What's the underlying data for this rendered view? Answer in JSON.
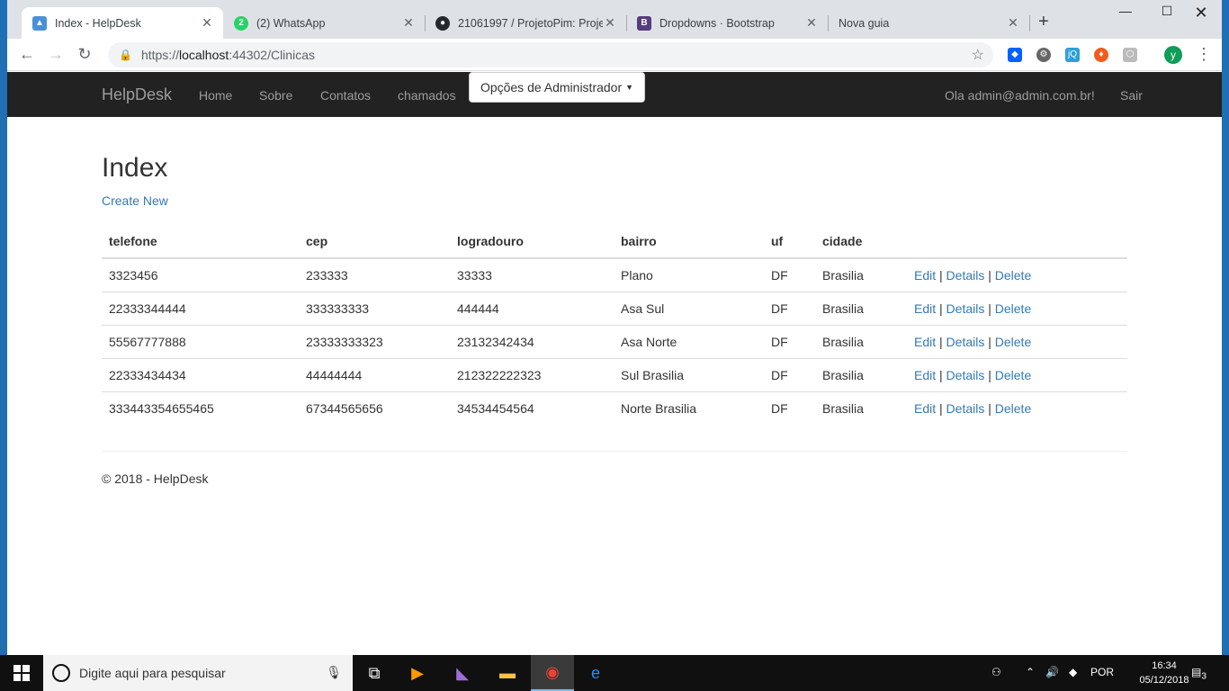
{
  "browser": {
    "tabs": [
      {
        "label": "Index - HelpDesk",
        "icon": "helpdesk-icon",
        "active": true
      },
      {
        "label": "(2) WhatsApp",
        "icon": "whatsapp-icon",
        "badge": "2"
      },
      {
        "label": "21061997 / ProjetoPim: Projet",
        "icon": "github-icon"
      },
      {
        "label": "Dropdowns · Bootstrap",
        "icon": "bootstrap-icon",
        "badge": "B"
      },
      {
        "label": "Nova guia",
        "icon": "blank-tab-icon"
      }
    ],
    "address": {
      "prefix": "https://",
      "host": "localhost",
      "rest": ":44302/Clinicas"
    },
    "profile_initial": "y"
  },
  "navbar": {
    "brand": "HelpDesk",
    "links": [
      "Home",
      "Sobre",
      "Contatos",
      "chamados"
    ],
    "admin_dropdown": "Opções de Administrador",
    "greeting": "Ola admin@admin.com.br!",
    "logout": "Sair"
  },
  "main": {
    "title": "Index",
    "create_new": "Create New",
    "columns": [
      "telefone",
      "cep",
      "logradouro",
      "bairro",
      "uf",
      "cidade"
    ],
    "rows": [
      {
        "telefone": "3323456",
        "cep": "233333",
        "logradouro": "33333",
        "bairro": "Plano",
        "uf": "DF",
        "cidade": "Brasilia"
      },
      {
        "telefone": "22333344444",
        "cep": "333333333",
        "logradouro": "444444",
        "bairro": "Asa Sul",
        "uf": "DF",
        "cidade": "Brasilia"
      },
      {
        "telefone": "55567777888",
        "cep": "23333333323",
        "logradouro": "23132342434",
        "bairro": "Asa Norte",
        "uf": "DF",
        "cidade": "Brasilia"
      },
      {
        "telefone": "22333434434",
        "cep": "44444444",
        "logradouro": "212322222323",
        "bairro": "Sul Brasilia",
        "uf": "DF",
        "cidade": "Brasilia"
      },
      {
        "telefone": "333443354655465",
        "cep": "67344565656",
        "logradouro": "34534454564",
        "bairro": "Norte Brasilia",
        "uf": "DF",
        "cidade": "Brasilia"
      }
    ],
    "actions": {
      "edit": "Edit",
      "details": "Details",
      "delete": "Delete",
      "sep": "|"
    }
  },
  "footer": {
    "text": "© 2018 - HelpDesk"
  },
  "taskbar": {
    "search_placeholder": "Digite aqui para pesquisar",
    "lang": "POR",
    "time": "16:34",
    "date": "05/12/2018",
    "notifications": "3"
  },
  "colors": {
    "navbar_bg": "#222222",
    "link": "#337ab7",
    "taskbar_bg": "#101010"
  }
}
